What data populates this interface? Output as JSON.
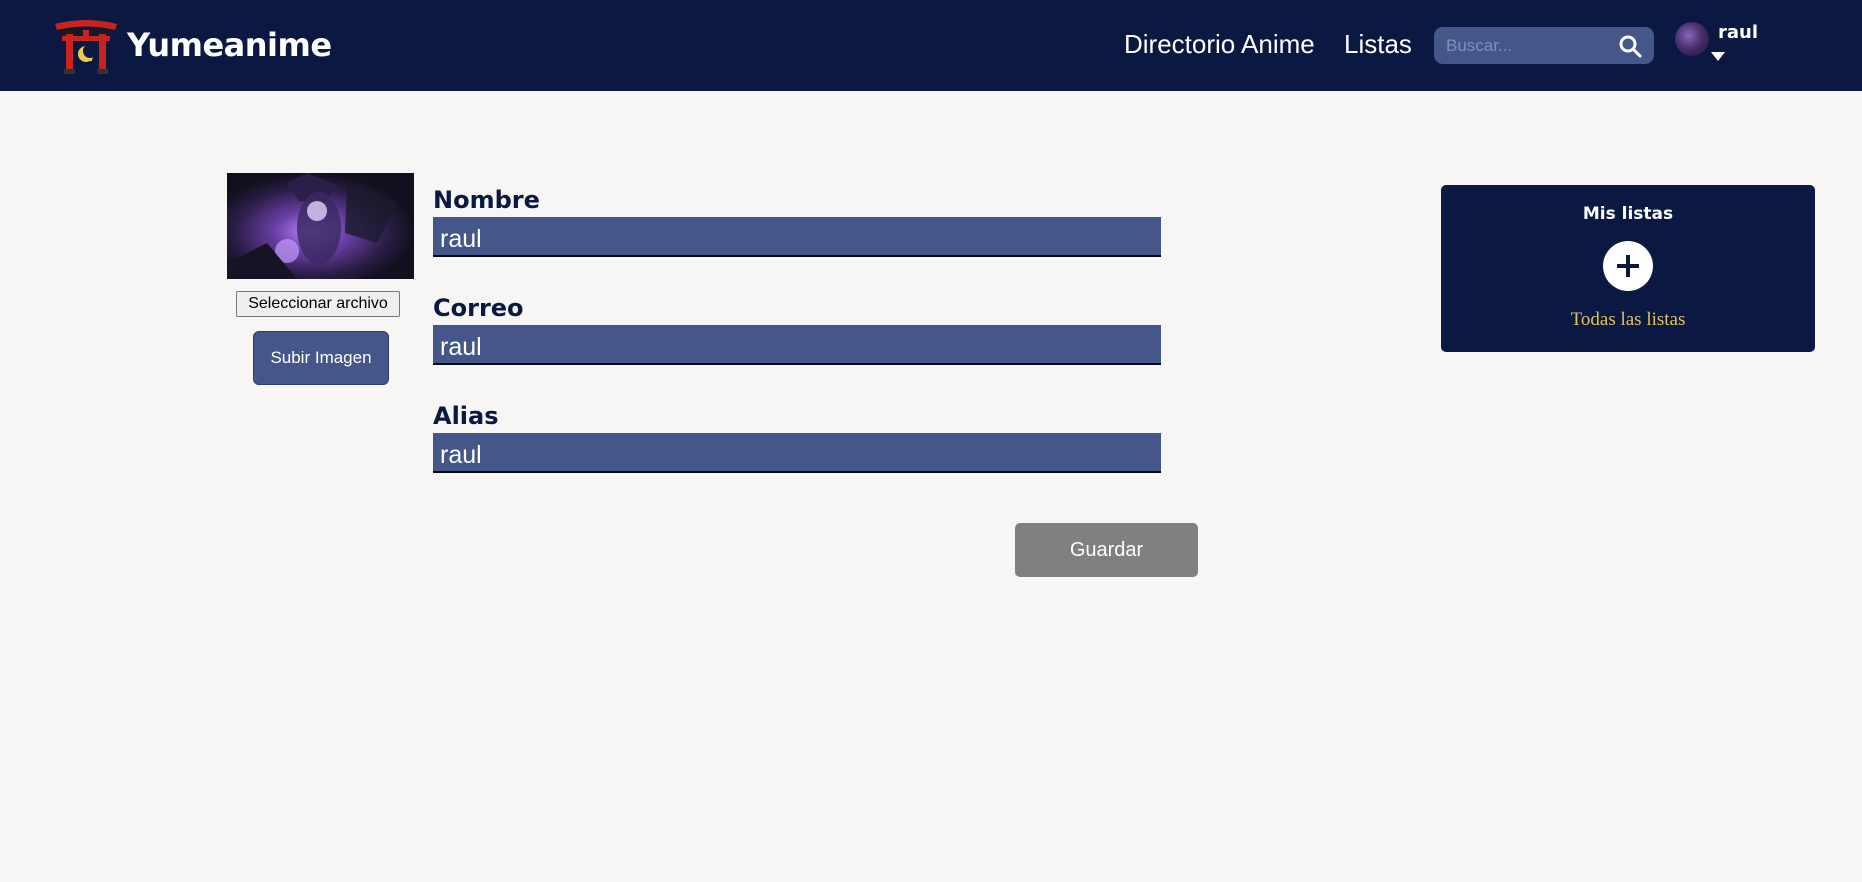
{
  "navbar": {
    "brand": "Yumeanime",
    "logo_icon": "torii-gate-icon",
    "links": [
      "Directorio Anime",
      "Listas"
    ],
    "search": {
      "placeholder": "Buscar...",
      "value": ""
    },
    "user": {
      "name": "raul",
      "avatar_icon": "user-avatar",
      "caret_icon": "caret-down-icon"
    }
  },
  "profile": {
    "image_alt": "Foto de perfil",
    "file_button_label": "Seleccionar archivo",
    "upload_button_label": "Subir Imagen"
  },
  "form": {
    "fields": [
      {
        "label": "Nombre",
        "value": "raul"
      },
      {
        "label": "Correo",
        "value": "raul"
      },
      {
        "label": "Alias",
        "value": "raul"
      }
    ],
    "save_label": "Guardar"
  },
  "lists_panel": {
    "title": "Mis listas",
    "add_icon": "plus-icon",
    "all_lists_label": "Todas las listas"
  },
  "colors": {
    "navy": "#0a1842",
    "field": "#45578a",
    "background": "#f8f6f4",
    "save_button": "#808080",
    "link_gold": "#e3c35a"
  }
}
